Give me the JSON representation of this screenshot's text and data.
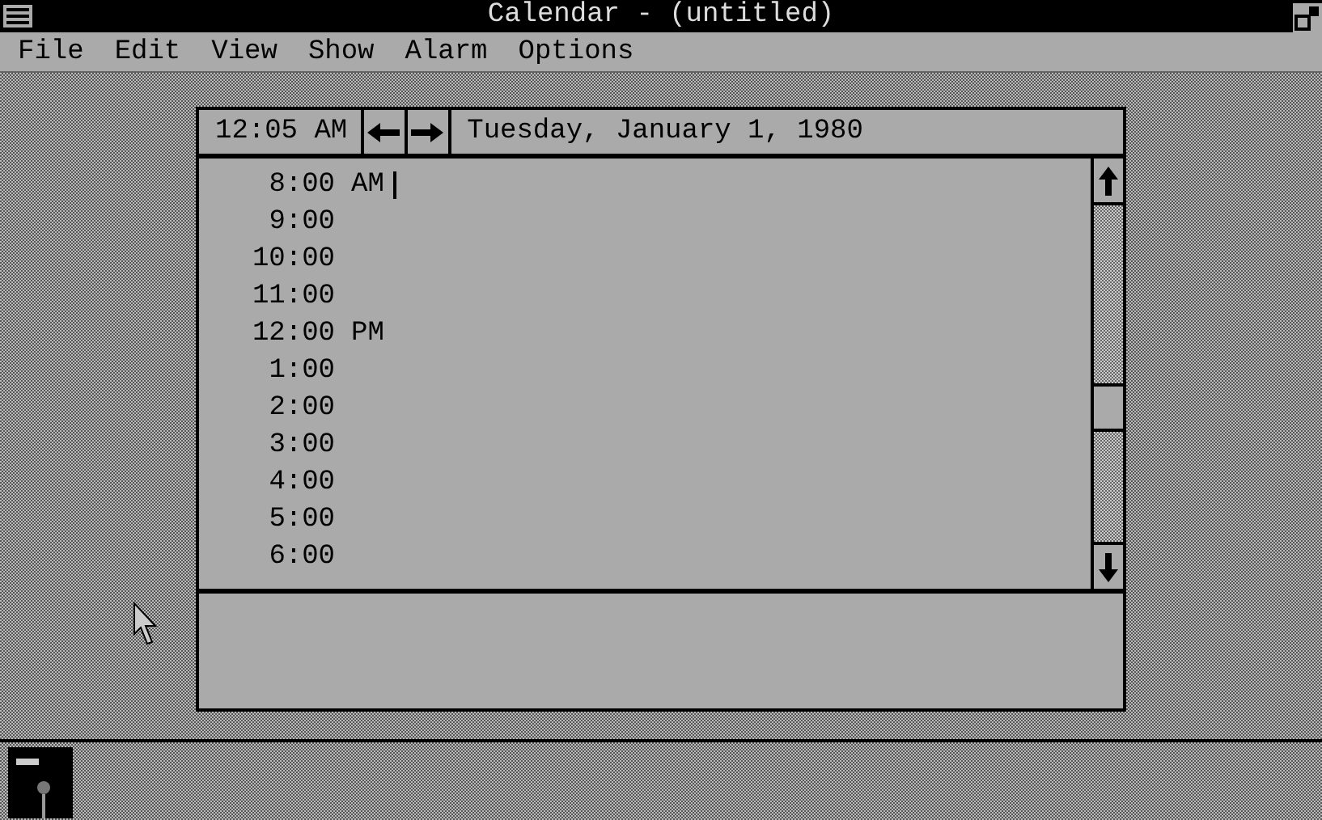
{
  "window": {
    "title": "Calendar - (untitled)"
  },
  "menu": [
    "File",
    "Edit",
    "View",
    "Show",
    "Alarm",
    "Options"
  ],
  "header": {
    "clock": "12:05 AM",
    "date": "Tuesday, January 1, 1980"
  },
  "appointments": [
    {
      "time": "8:00",
      "suffix": "AM",
      "cursor": true
    },
    {
      "time": "9:00",
      "cursor": false
    },
    {
      "time": "10:00",
      "cursor": false
    },
    {
      "time": "11:00",
      "cursor": false
    },
    {
      "time": "12:00",
      "suffix": "PM",
      "cursor": false
    },
    {
      "time": "1:00",
      "cursor": false
    },
    {
      "time": "2:00",
      "cursor": false
    },
    {
      "time": "3:00",
      "cursor": false
    },
    {
      "time": "4:00",
      "cursor": false
    },
    {
      "time": "5:00",
      "cursor": false
    },
    {
      "time": "6:00",
      "cursor": false
    }
  ]
}
